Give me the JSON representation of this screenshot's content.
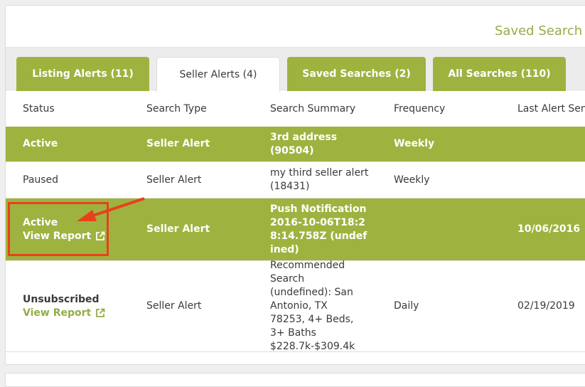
{
  "panel": {
    "title": "Saved Search &"
  },
  "tabs": [
    {
      "label": "Listing Alerts (11)",
      "active": false
    },
    {
      "label": "Seller Alerts (4)",
      "active": true
    },
    {
      "label": "Saved Searches (2)",
      "active": false
    },
    {
      "label": "All Searches (110)",
      "active": false
    }
  ],
  "table": {
    "headers": [
      "Status",
      "Search Type",
      "Search Summary",
      "Frequency",
      "Last Alert Sent"
    ],
    "rows": [
      {
        "status": "Active",
        "type": "Seller Alert",
        "summary": "3rd address (90504)",
        "frequency": "Weekly",
        "last_sent": "",
        "link": ""
      },
      {
        "status": "Paused",
        "type": "Seller Alert",
        "summary": "my third seller alert (18431)",
        "frequency": "Weekly",
        "last_sent": "",
        "link": ""
      },
      {
        "status": "Active",
        "type": "Seller Alert",
        "summary": "Push Notification 2016-10-06T18:28:14.758Z (undefined)",
        "frequency": "",
        "last_sent": "10/06/2016",
        "link": "View Report"
      },
      {
        "status": "Unsubscribed",
        "type": "Seller Alert",
        "summary": "Recommended Search (undefined): San Antonio, TX 78253, 4+ Beds, 3+ Baths $228.7k-$309.4k",
        "frequency": "Daily",
        "last_sent": "02/19/2019",
        "link": "View Report"
      }
    ]
  },
  "icons": {
    "external_link": "external-link-icon"
  },
  "colors": {
    "accent": "#9eb33f",
    "annotation": "#e8401c",
    "title": "#93ad46"
  }
}
